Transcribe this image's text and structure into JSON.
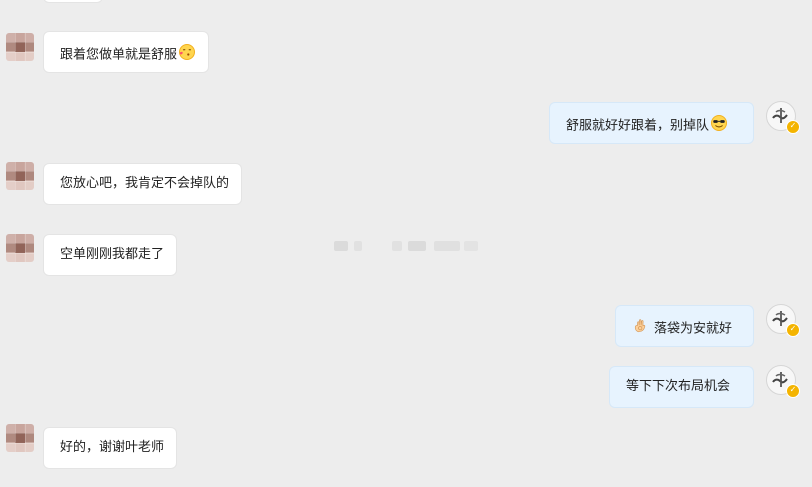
{
  "messages": [
    {
      "side": "left",
      "text": "跟着您做单就是舒服",
      "emoji": "kiss-face-icon"
    },
    {
      "side": "right",
      "text": "舒服就好好跟着，别掉队",
      "emoji": "sunglasses-face-icon"
    },
    {
      "side": "left",
      "text": "您放心吧，我肯定不会掉队的"
    },
    {
      "side": "left",
      "text": "空单刚刚我都走了"
    },
    {
      "side": "right",
      "text": "落袋为安就好",
      "emoji": "ok-hand-icon"
    },
    {
      "side": "right",
      "text": "等下下次布局机会"
    },
    {
      "side": "left",
      "text": "好的，谢谢叶老师"
    }
  ],
  "colors": {
    "background": "#ededed",
    "left_bubble": "#ffffff",
    "right_bubble": "#e7f3fe",
    "verified_badge": "#f4b400"
  }
}
